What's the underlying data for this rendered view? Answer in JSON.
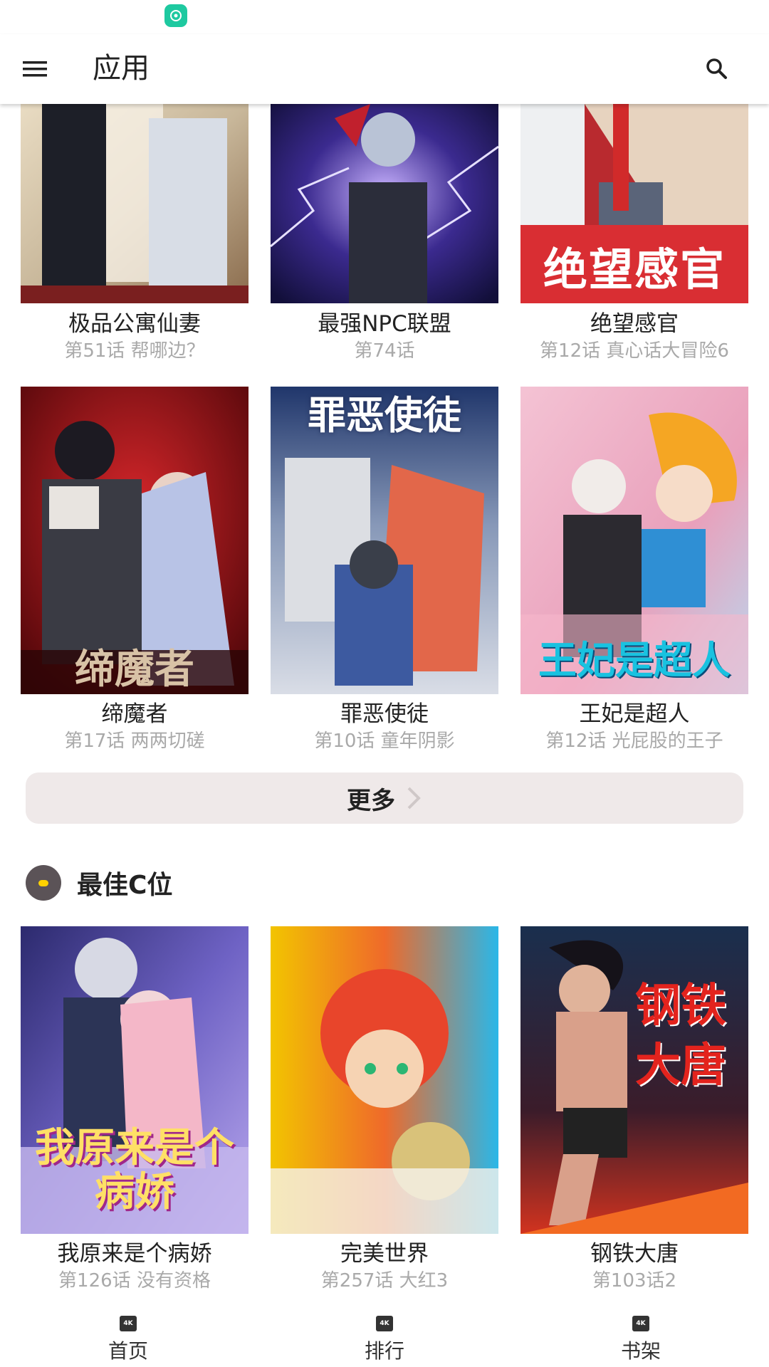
{
  "app_bar": {
    "title": "应用"
  },
  "row1": [
    {
      "title": "极品公寓仙妻",
      "subtitle": "第51话 帮哪边？"
    },
    {
      "title": "最强NPC联盟",
      "subtitle": "第74话"
    },
    {
      "title": "绝望感官",
      "subtitle": "第12话 真心话大冒险6",
      "cover_text": "绝望感官"
    }
  ],
  "row2": [
    {
      "title": "缔魔者",
      "subtitle": "第17话 两两切磋",
      "cover_text": "缔魔者"
    },
    {
      "title": "罪恶使徒",
      "subtitle": "第10话 童年阴影",
      "cover_text": "罪恶使徒"
    },
    {
      "title": "王妃是超人",
      "subtitle": "第12话 光屁股的王子",
      "cover_text": "王妃是超人"
    }
  ],
  "more_button": {
    "label": "更多"
  },
  "section": {
    "title": "最佳C位"
  },
  "row3": [
    {
      "title": "我原来是个病娇",
      "subtitle": "第126话 没有资格",
      "cover_text": "我原来是个病娇"
    },
    {
      "title": "完美世界",
      "subtitle": "第257话 大红3"
    },
    {
      "title": "钢铁大唐",
      "subtitle": "第103话2",
      "cover_text": "钢铁大唐"
    }
  ],
  "bottom_nav": {
    "icon_text": "4K",
    "items": [
      {
        "label": "首页"
      },
      {
        "label": "排行"
      },
      {
        "label": "书架"
      }
    ]
  },
  "colors": {
    "accent_status_icon": "#1ec9a0",
    "more_button_bg": "#efe9e9",
    "subtitle_gray": "#a9a9a9"
  }
}
